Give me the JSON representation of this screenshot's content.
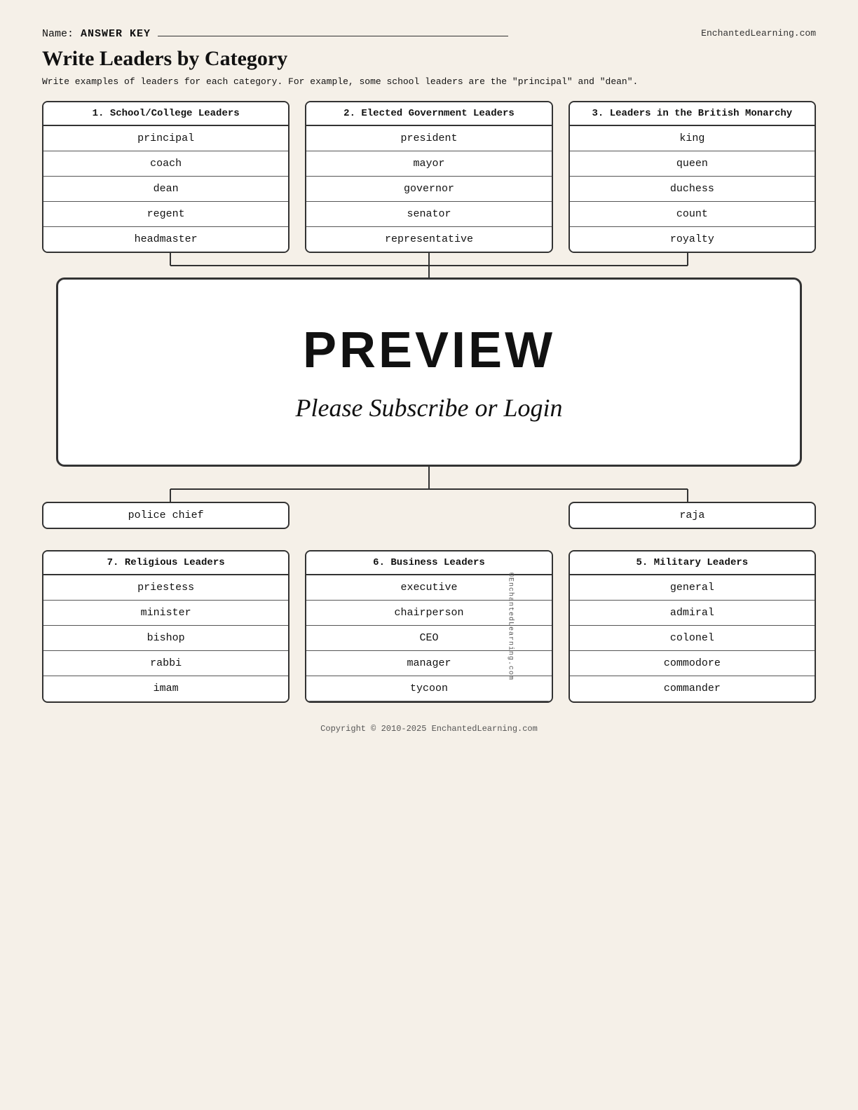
{
  "header": {
    "name_label": "Name:",
    "name_value": "ANSWER KEY",
    "site_url": "EnchantedLearning.com"
  },
  "title": "Write Leaders by Category",
  "instructions": "Write examples of leaders for each category. For example, some school leaders are the \"principal\" and \"dean\".",
  "categories": {
    "top": [
      {
        "id": "cat1",
        "header": "1. School/College Leaders",
        "items": [
          "principal",
          "coach",
          "dean",
          "regent",
          "headmaster"
        ]
      },
      {
        "id": "cat2",
        "header": "2. Elected Government Leaders",
        "items": [
          "president",
          "mayor",
          "governor",
          "senator",
          "representative"
        ]
      },
      {
        "id": "cat3",
        "header": "3. Leaders in the British Monarchy",
        "items": [
          "king",
          "queen",
          "duchess",
          "count",
          "royalty"
        ]
      }
    ],
    "bottom": [
      {
        "id": "cat7",
        "header": "7. Religious Leaders",
        "items": [
          "priestess",
          "minister",
          "bishop",
          "rabbi",
          "imam"
        ]
      },
      {
        "id": "cat6",
        "header": "6. Business Leaders",
        "items": [
          "executive",
          "chairperson",
          "CEO",
          "manager",
          "tycoon"
        ]
      },
      {
        "id": "cat5",
        "header": "5. Military Leaders",
        "items": [
          "general",
          "admiral",
          "colonel",
          "commodore",
          "commander"
        ]
      }
    ]
  },
  "partial_visible": {
    "left_item": "police chief",
    "right_item": "raja"
  },
  "preview": {
    "title": "PREVIEW",
    "subtitle": "Please Subscribe or Login"
  },
  "watermark": "©EnchantedLearning.com",
  "footer": "Copyright © 2010-2025 EnchantedLearning.com"
}
